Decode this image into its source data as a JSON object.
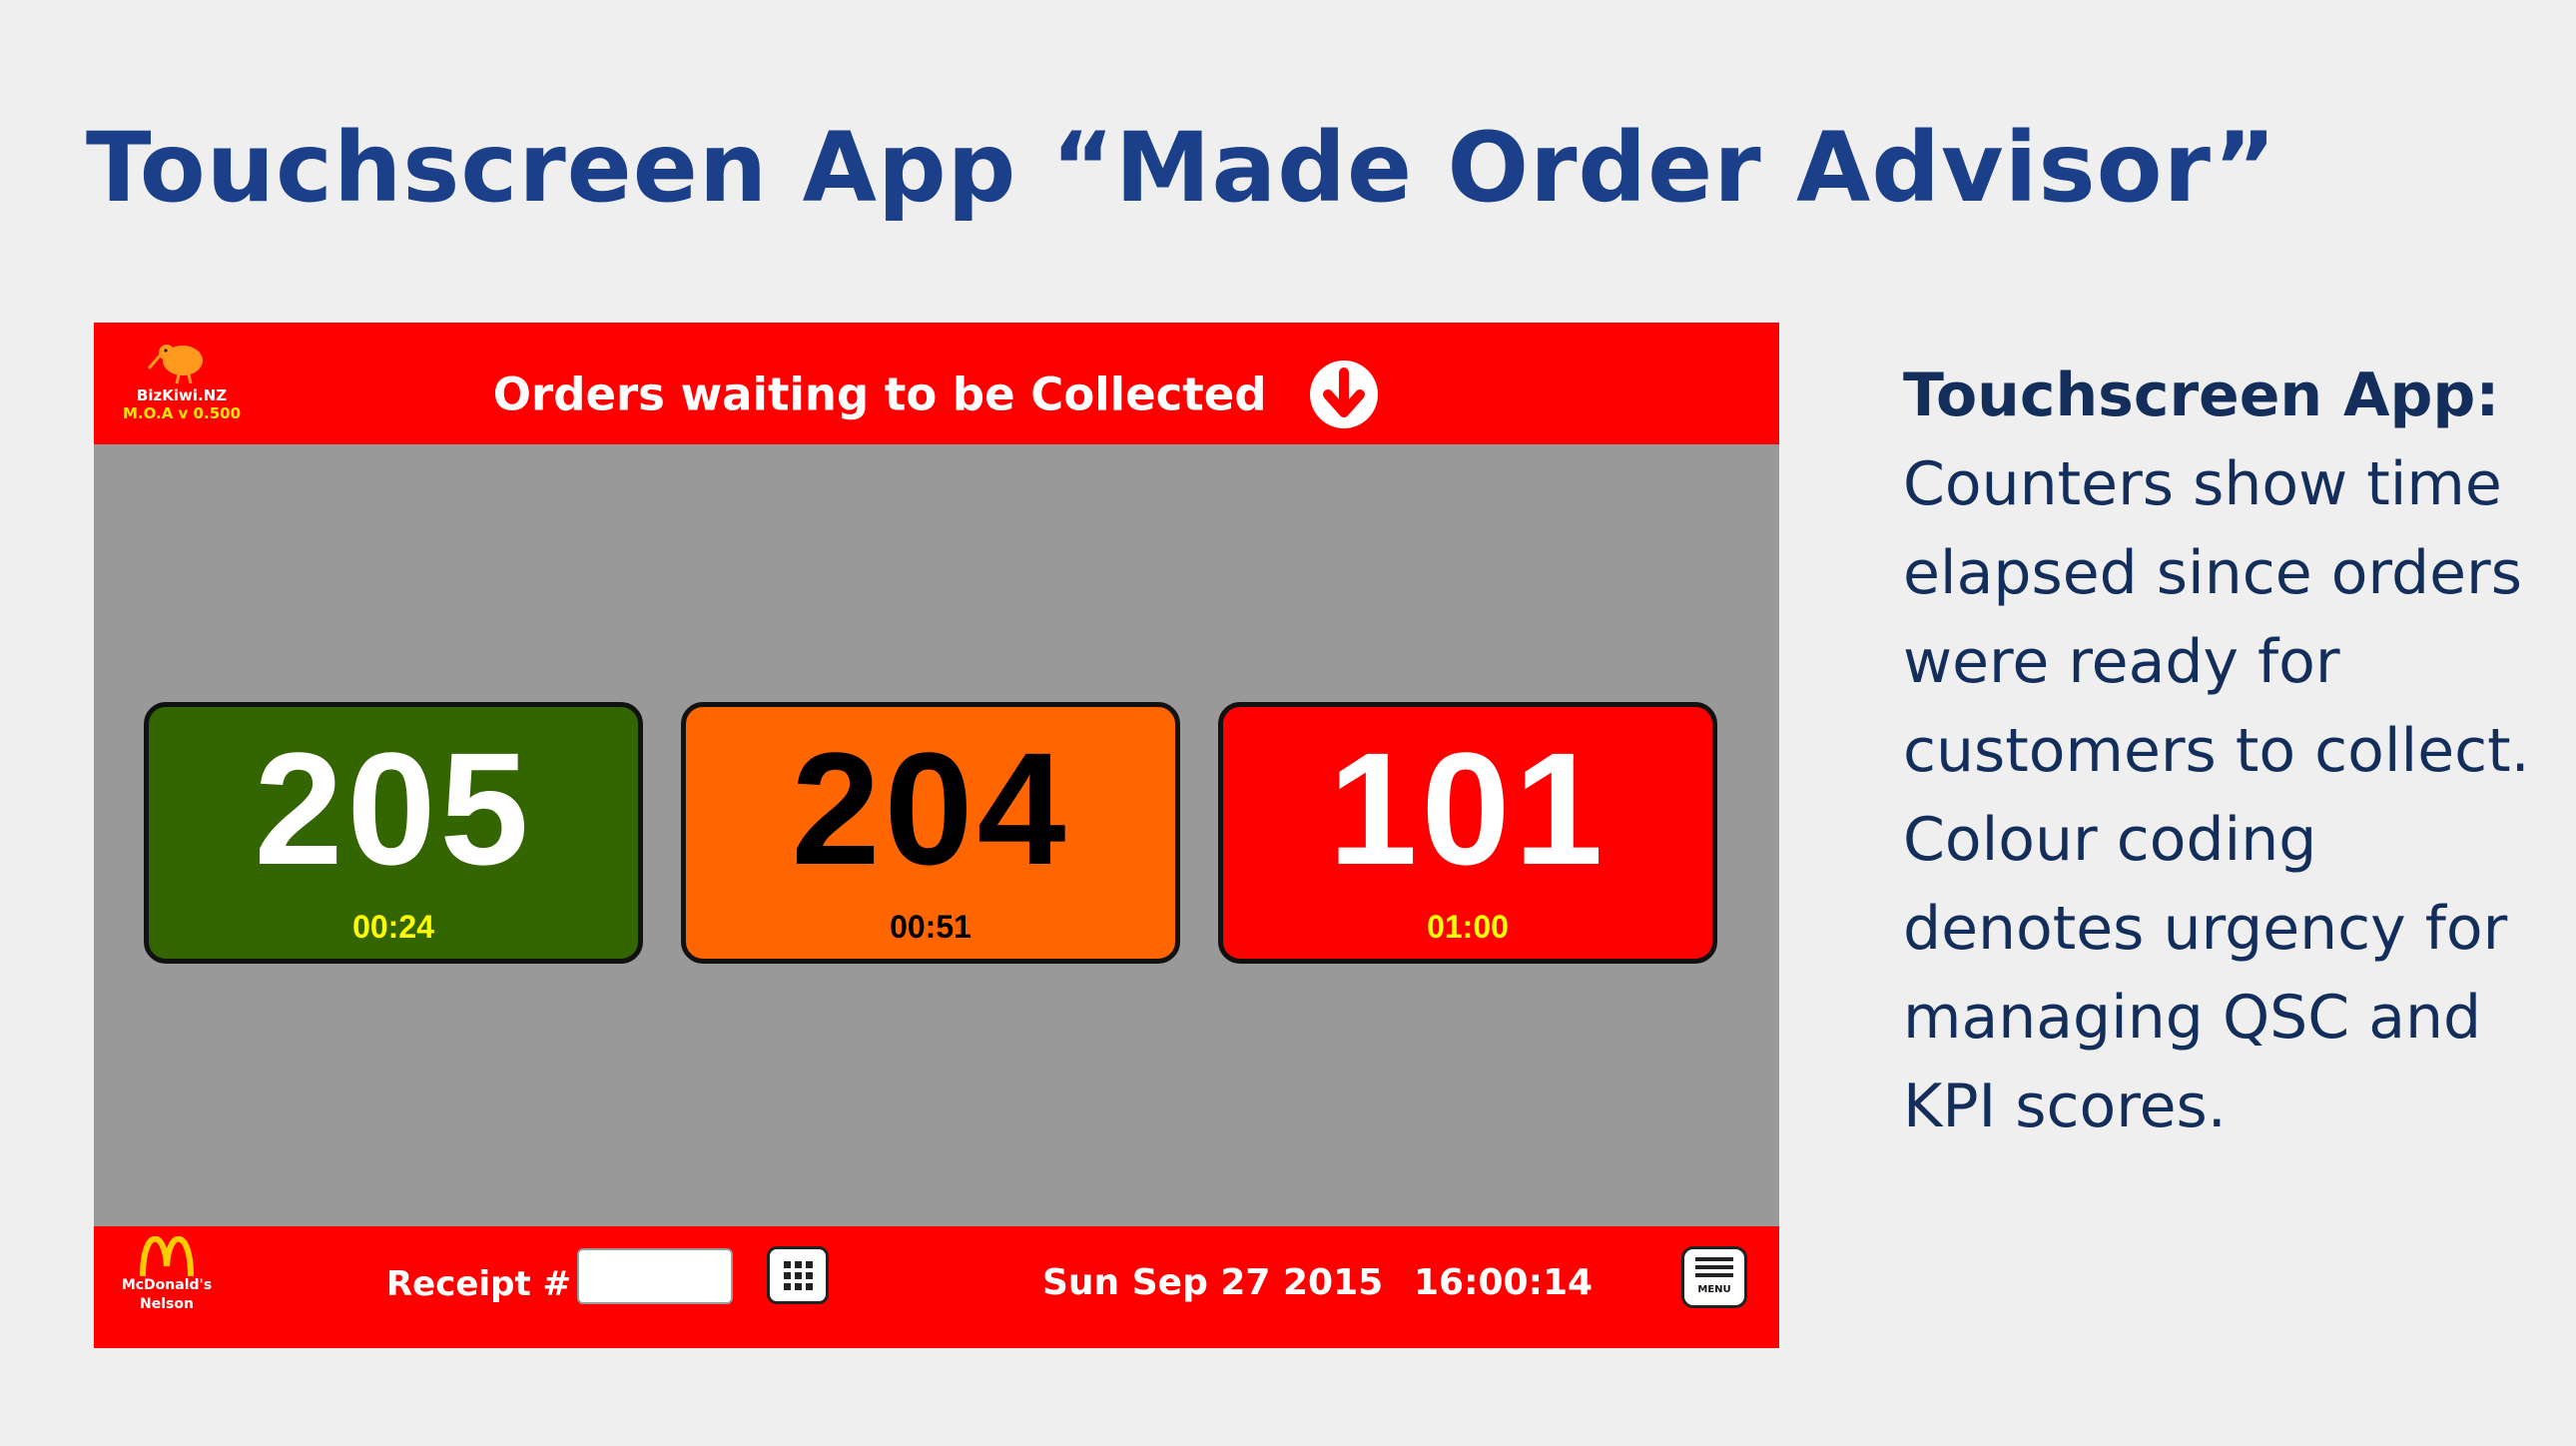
{
  "slide": {
    "title": "Touchscreen App “Made Order Advisor”",
    "heading": "Touchscreen App:",
    "body": "Counters show time elapsed since orders were ready for customers to collect. Colour coding denotes urgency for managing QSC and KPI scores.",
    "title_color": "#1c3f8a",
    "text_color": "#142e5c"
  },
  "app": {
    "brand": {
      "name": "BizKiwi.NZ",
      "version": "M.O.A v 0.500",
      "icon": "kiwi-bird-icon"
    },
    "header": {
      "title": "Orders waiting to be Collected",
      "icon": "arrow-down-circle-icon"
    },
    "bar_color": "#ff0000",
    "body_color": "#999999",
    "orders": [
      {
        "number": "205",
        "elapsed": "00:24",
        "status": "green",
        "bg": "#336600",
        "number_color": "#ffffff",
        "time_color": "#ffff00"
      },
      {
        "number": "204",
        "elapsed": "00:51",
        "status": "orange",
        "bg": "#ff6600",
        "number_color": "#000000",
        "time_color": "#000000"
      },
      {
        "number": "101",
        "elapsed": "01:00",
        "status": "red",
        "bg": "#ff0000",
        "number_color": "#ffffff",
        "time_color": "#ffff00"
      }
    ],
    "footer": {
      "store_name": "McDonald's",
      "store_city": "Nelson",
      "store_icon": "golden-arches-icon",
      "receipt_label": "Receipt #",
      "receipt_value": "",
      "keypad_icon": "keypad-icon",
      "date": "Sun Sep 27 2015",
      "time": "16:00:14",
      "menu_label": "MENU",
      "menu_icon": "hamburger-menu-icon"
    }
  }
}
